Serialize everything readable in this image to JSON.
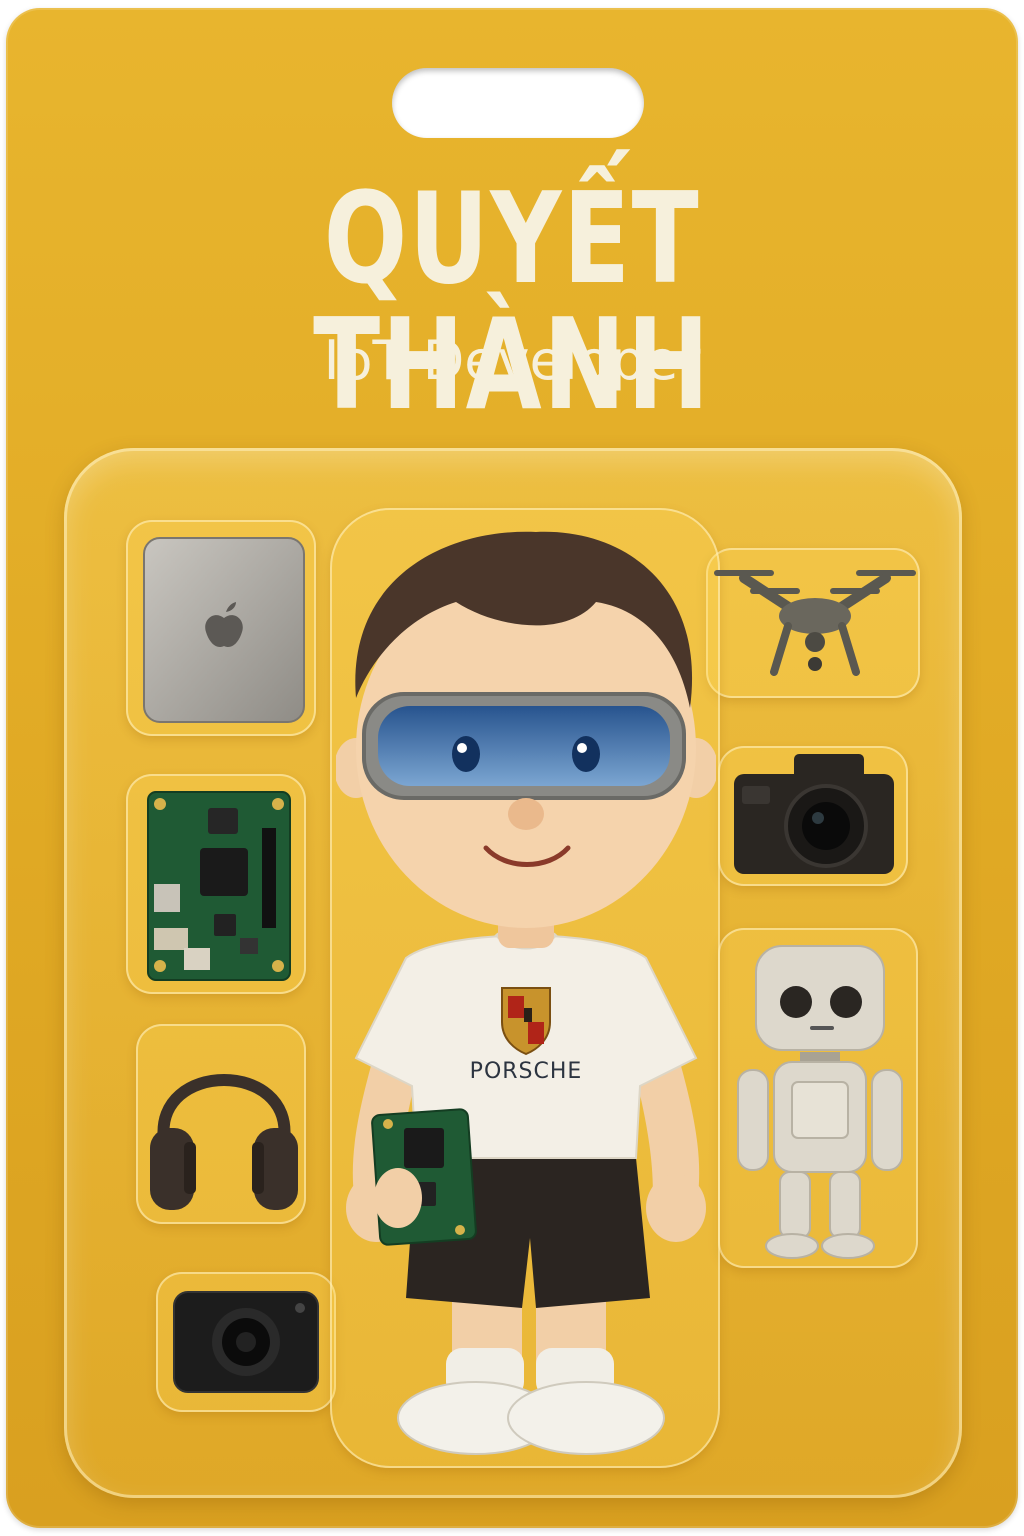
{
  "package": {
    "name": "QUYẾT THÀNH",
    "role": "IoT Developer"
  },
  "figure": {
    "shirt_brand": "PORSCHE"
  },
  "accessories": [
    {
      "icon": "laptop-icon",
      "position": "left-top"
    },
    {
      "icon": "circuit-board-icon",
      "position": "left"
    },
    {
      "icon": "headphones-icon",
      "position": "left"
    },
    {
      "icon": "webcam-icon",
      "position": "left-bottom"
    },
    {
      "icon": "drone-icon",
      "position": "right-top"
    },
    {
      "icon": "camera-icon",
      "position": "right"
    },
    {
      "icon": "robot-icon",
      "position": "right-bottom"
    }
  ],
  "colors": {
    "card": "#e0a924",
    "title": "#f6f0dc"
  }
}
